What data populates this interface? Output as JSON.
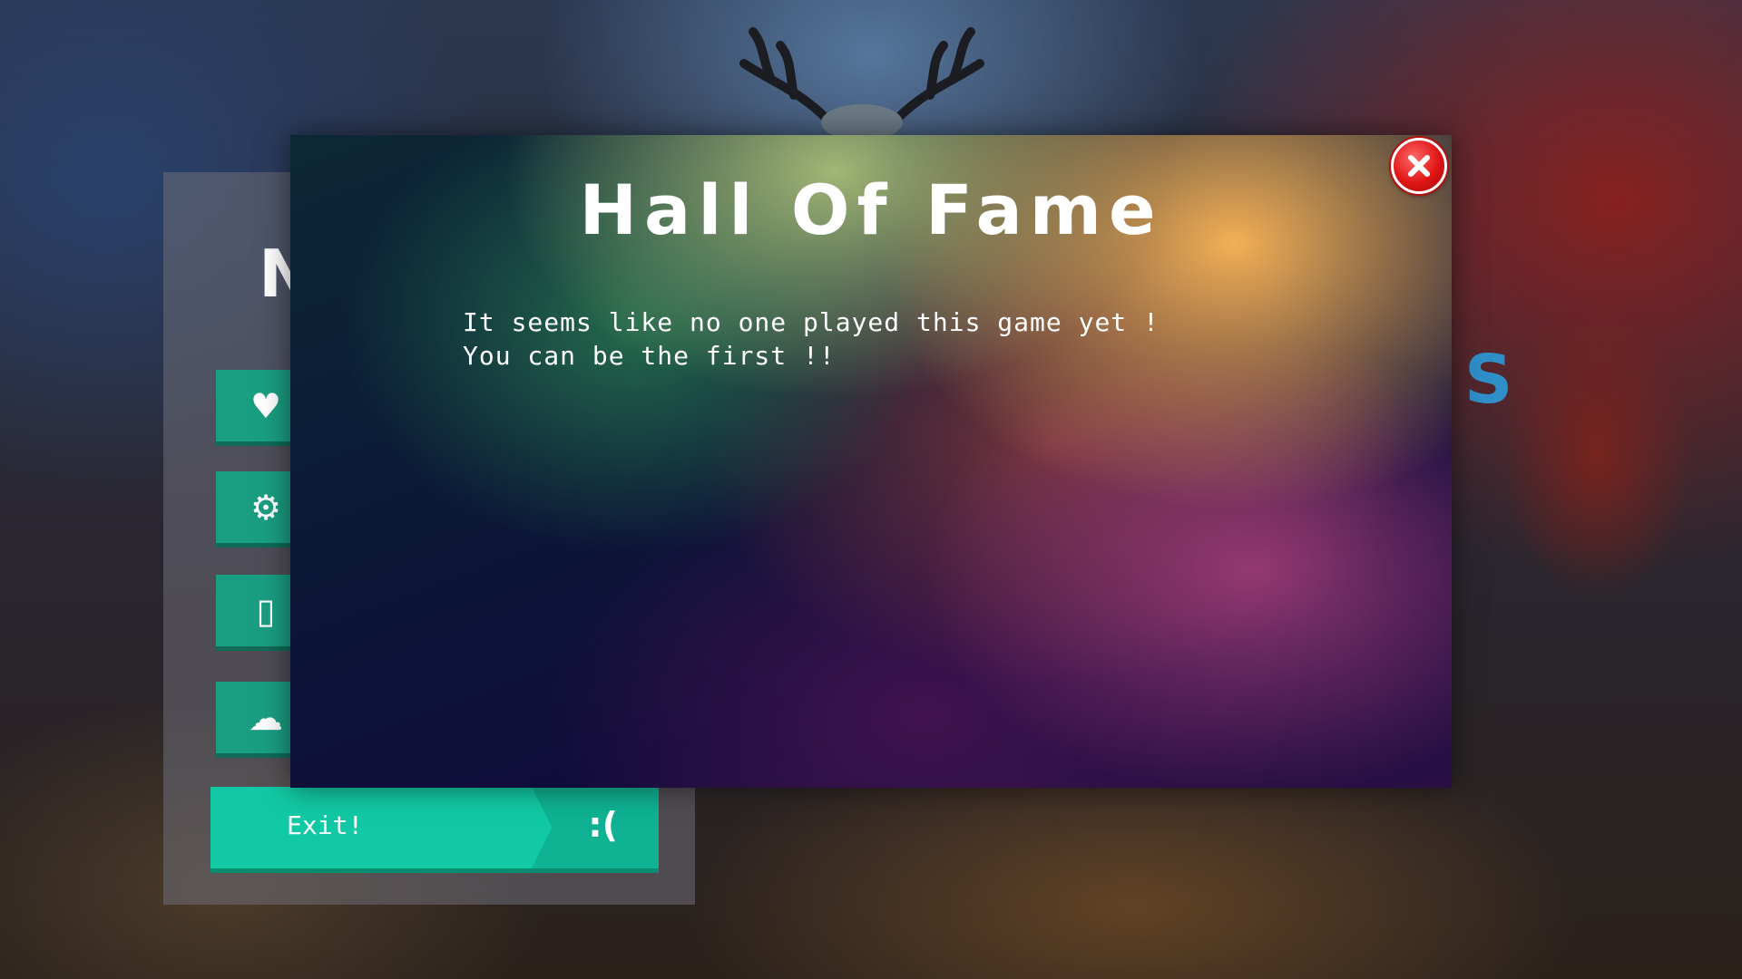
{
  "menu": {
    "title": "N",
    "buttons": [
      {
        "icon": "heart-icon",
        "glyph": "♥"
      },
      {
        "icon": "gear-icon",
        "glyph": "⚙"
      },
      {
        "icon": "tablet-icon",
        "glyph": "▯"
      },
      {
        "icon": "cloud-download-icon",
        "glyph": "☁"
      }
    ],
    "exit": {
      "label": "Exit!",
      "face": ":("
    },
    "side_letter": "S"
  },
  "dialog": {
    "title": "Hall Of Fame",
    "message_line1": "It seems like no one played this game yet !",
    "message_line2": "You can be the first !!",
    "close_icon": "close-icon"
  },
  "colors": {
    "accent_teal": "#12c9a5",
    "close_red": "#e01515",
    "side_letter_blue": "#2f8fc8"
  }
}
